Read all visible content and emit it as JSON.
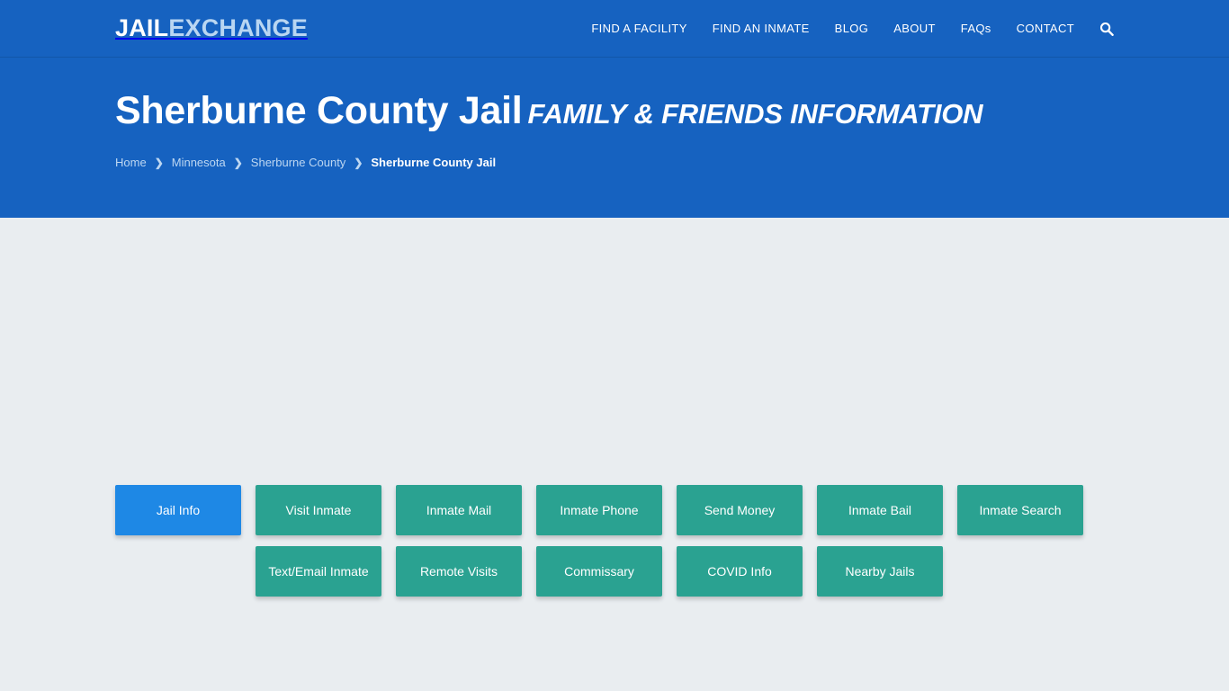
{
  "header": {
    "logo": {
      "primary": "JAIL",
      "secondary": "EXCHANGE",
      "primary_color": "#ffffff",
      "secondary_color": "#b9d6f2"
    },
    "background_color": "#1662c0",
    "nav": [
      {
        "label": "FIND A FACILITY",
        "name": "nav-find-a-facility"
      },
      {
        "label": "FIND AN INMATE",
        "name": "nav-find-an-inmate"
      },
      {
        "label": "BLOG",
        "name": "nav-blog"
      },
      {
        "label": "ABOUT",
        "name": "nav-about"
      },
      {
        "label": "FAQs",
        "name": "nav-faqs"
      },
      {
        "label": "CONTACT",
        "name": "nav-contact"
      }
    ],
    "search_icon": "search-icon"
  },
  "hero": {
    "title_main": "Sherburne County Jail",
    "title_sub": "FAMILY & FRIENDS INFORMATION",
    "breadcrumb": [
      {
        "label": "Home",
        "current": false
      },
      {
        "label": "Minnesota",
        "current": false
      },
      {
        "label": "Sherburne County",
        "current": false
      },
      {
        "label": "Sherburne County Jail",
        "current": true
      }
    ],
    "breadcrumb_separator": "›"
  },
  "main": {
    "background_color": "#e9edf0",
    "tabs": {
      "active_color": "#1e88e5",
      "inactive_color": "#2aa291",
      "row1": [
        {
          "label": "Jail Info",
          "active": true
        },
        {
          "label": "Visit Inmate",
          "active": false
        },
        {
          "label": "Inmate Mail",
          "active": false
        },
        {
          "label": "Inmate Phone",
          "active": false
        },
        {
          "label": "Send Money",
          "active": false
        },
        {
          "label": "Inmate Bail",
          "active": false
        },
        {
          "label": "Inmate Search",
          "active": false
        }
      ],
      "row2": [
        {
          "label": "Text/Email Inmate",
          "active": false
        },
        {
          "label": "Remote Visits",
          "active": false
        },
        {
          "label": "Commissary",
          "active": false
        },
        {
          "label": "COVID Info",
          "active": false
        },
        {
          "label": "Nearby Jails",
          "active": false
        }
      ]
    }
  }
}
